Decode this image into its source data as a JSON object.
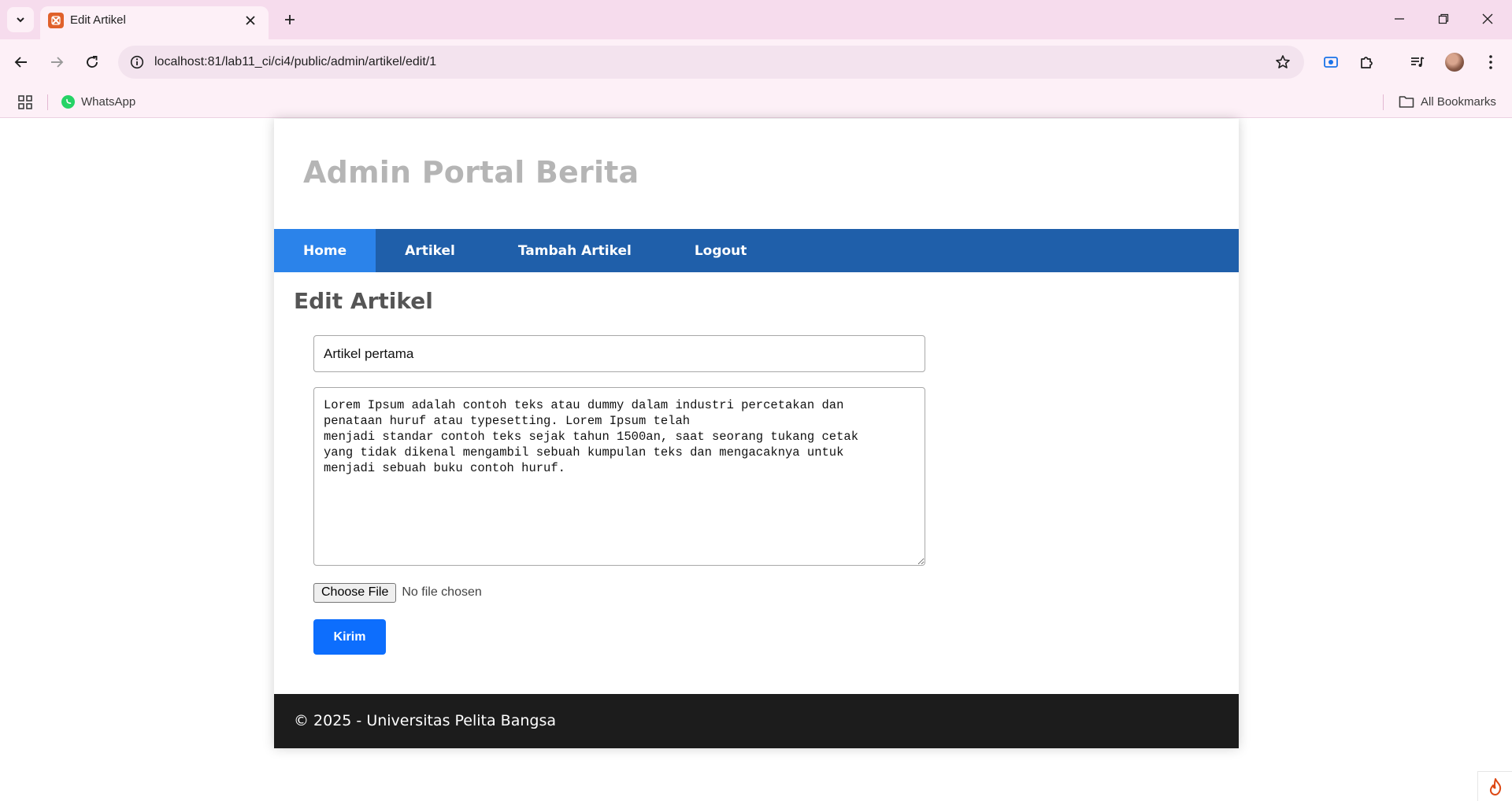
{
  "browser": {
    "tab_title": "Edit Artikel",
    "url": "localhost:81/lab11_ci/ci4/public/admin/artikel/edit/1",
    "bookmarks": [
      {
        "label": "WhatsApp",
        "icon": "whatsapp-icon"
      }
    ],
    "all_bookmarks_label": "All Bookmarks",
    "colors": {
      "tabstrip": "#f6dced",
      "toolbar": "#fdf0f7"
    }
  },
  "site": {
    "title": "Admin Portal Berita",
    "nav": [
      {
        "label": "Home",
        "active": true
      },
      {
        "label": "Artikel",
        "active": false
      },
      {
        "label": "Tambah Artikel",
        "active": false
      },
      {
        "label": "Logout",
        "active": false
      }
    ],
    "colors": {
      "nav_bg": "#1f5faa",
      "nav_active": "#2b83ea",
      "footer_bg": "#1c1c1c",
      "button": "#0d6efd"
    }
  },
  "form": {
    "heading": "Edit Artikel",
    "title_value": "Artikel pertama",
    "body_value": "Lorem Ipsum adalah contoh teks atau dummy dalam industri percetakan dan\npenataan huruf atau typesetting. Lorem Ipsum telah\nmenjadi standar contoh teks sejak tahun 1500an, saat seorang tukang cetak\nyang tidak dikenal mengambil sebuah kumpulan teks dan mengacaknya untuk\nmenjadi sebuah buku contoh huruf.",
    "file_button_label": "Choose File",
    "file_status": "No file chosen",
    "submit_label": "Kirim"
  },
  "footer": {
    "text": "© 2025 - Universitas Pelita Bangsa"
  }
}
